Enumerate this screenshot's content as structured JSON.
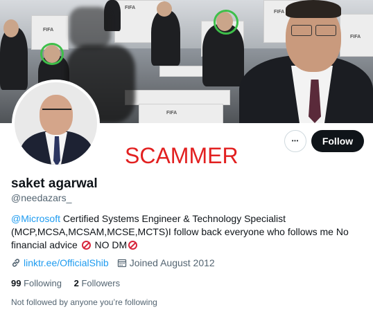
{
  "profile": {
    "name": "saket agarwal",
    "handle": "@needazars_",
    "bio_mention": "@Microsoft",
    "bio_line1_rest": " Certified Systems Engineer & Technology Specialist",
    "bio_line2": "(MCP,MCSA,MCSAM,MCSE,MCTS)I follow back everyone who follows me No",
    "bio_line3_a": "financial advice ",
    "bio_line3_b": " NO DM",
    "website": "linktr.ee/OfficialShib",
    "joined": "Joined August 2012",
    "following_count": "99",
    "following_label": " Following",
    "followers_count": "2",
    "followers_label": " Followers",
    "not_followed": "Not followed by anyone you’re following"
  },
  "actions": {
    "more_label": "•••",
    "follow_label": "Follow"
  },
  "overlay": {
    "scammer_text": "SCAMMER"
  },
  "banner": {
    "fifa_text": "FIFA"
  },
  "colors": {
    "accent": "#1d9bf0",
    "follow_bg": "#0f1419",
    "scammer": "#e22020"
  }
}
